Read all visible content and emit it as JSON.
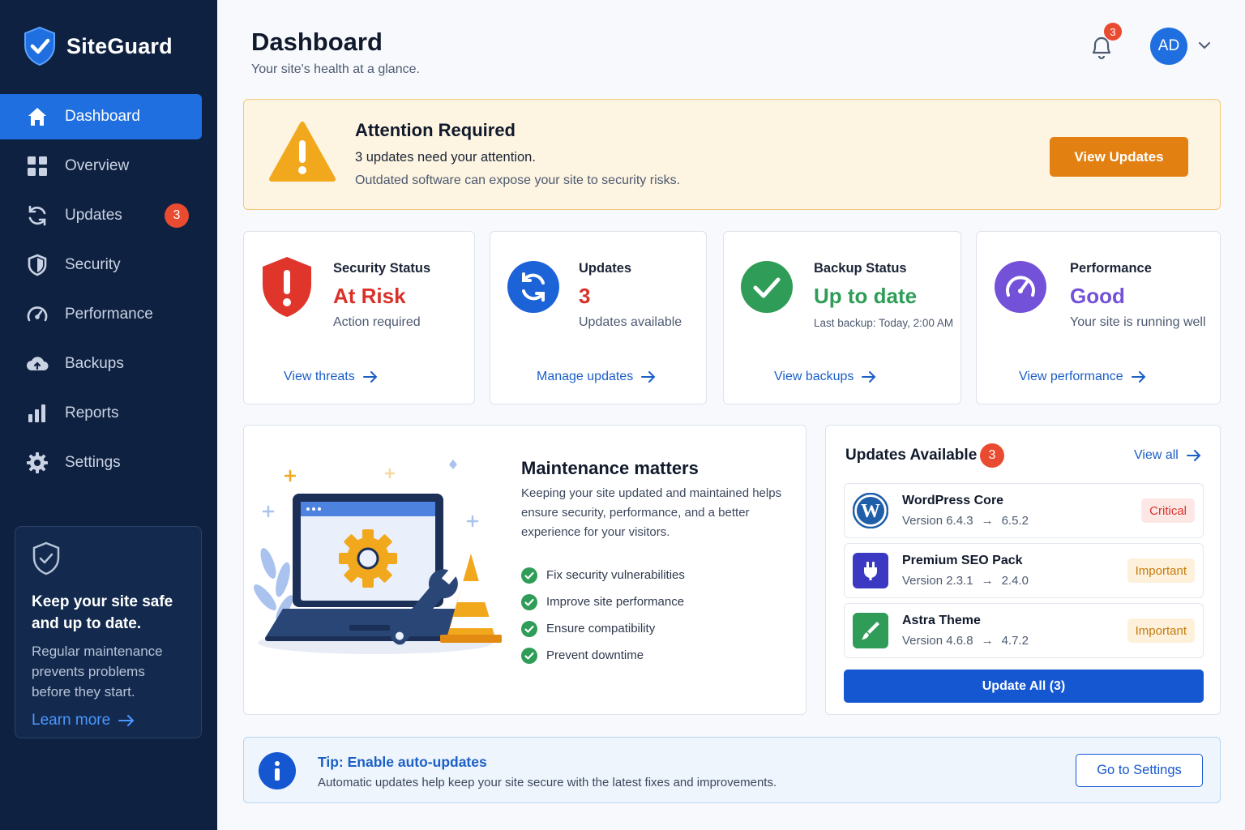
{
  "brand": {
    "name": "SiteGuard"
  },
  "sidebar": {
    "items": [
      {
        "label": "Dashboard",
        "icon": "home-icon",
        "active": true
      },
      {
        "label": "Overview",
        "icon": "grid-icon"
      },
      {
        "label": "Updates",
        "icon": "refresh-icon",
        "badge": "3"
      },
      {
        "label": "Security",
        "icon": "shield-icon"
      },
      {
        "label": "Performance",
        "icon": "gauge-icon"
      },
      {
        "label": "Backups",
        "icon": "cloud-icon"
      },
      {
        "label": "Reports",
        "icon": "bar-chart-icon"
      },
      {
        "label": "Settings",
        "icon": "gear-icon"
      }
    ],
    "promo": {
      "title": "Keep your site safe and up to date.",
      "text": "Regular maintenance prevents problems before they start.",
      "link": "Learn more"
    }
  },
  "header": {
    "title": "Dashboard",
    "subtitle": "Your site's health at a glance.",
    "notification_count": "3",
    "avatar_initials": "AD"
  },
  "alert": {
    "title": "Attention Required",
    "line1": "3 updates need your attention.",
    "line2": "Outdated software can expose your site to security risks.",
    "button": "View Updates"
  },
  "stats": [
    {
      "label": "Security Status",
      "value": "At Risk",
      "sub": "Action required",
      "link": "View threats",
      "color": "#d8322a"
    },
    {
      "label": "Updates",
      "value": "3",
      "sub": "Updates available",
      "link": "Manage updates",
      "color": "#d8322a"
    },
    {
      "label": "Backup Status",
      "value": "Up to date",
      "sub": "Last backup: Today, 2:00 AM",
      "link": "View backups",
      "color": "#2f9d57"
    },
    {
      "label": "Performance",
      "value": "Good",
      "sub": "Your site is running well",
      "link": "View performance",
      "color": "#7352d9"
    }
  ],
  "maintenance": {
    "title": "Maintenance matters",
    "text": "Keeping your site updated and maintained helps ensure security, performance, and a better experience for your visitors.",
    "items": [
      "Fix security vulnerabilities",
      "Improve site performance",
      "Ensure compatibility",
      "Prevent downtime"
    ]
  },
  "updates_panel": {
    "title": "Updates Available",
    "count": "3",
    "view_all": "View all",
    "items": [
      {
        "name": "WordPress Core",
        "version": "Version 6.4.3",
        "new_version": "6.5.2",
        "tag": "Critical",
        "icon": "wordpress-icon"
      },
      {
        "name": "Premium SEO Pack",
        "version": "Version 2.3.1",
        "new_version": "2.4.0",
        "tag": "Important",
        "icon": "plug-icon"
      },
      {
        "name": "Astra Theme",
        "version": "Version 4.6.8",
        "new_version": "4.7.2",
        "tag": "Important",
        "icon": "brush-icon"
      }
    ],
    "button": "Update All (3)"
  },
  "tip": {
    "title": "Tip: Enable auto-updates",
    "text": "Automatic updates help keep your site secure with the latest fixes and improvements.",
    "button": "Go to Settings"
  },
  "colors": {
    "sidebar": "#0f2141",
    "accent": "#1f6fe0",
    "warning": "#e38012",
    "danger": "#e84b2f",
    "success": "#2f9d57"
  }
}
